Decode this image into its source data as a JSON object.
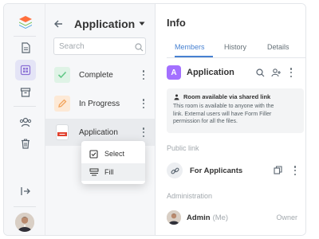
{
  "rail": {
    "logo_icon": "layers-logo-icon",
    "items": [
      "document-icon",
      "form-template-icon",
      "archive-icon",
      "users-icon",
      "trash-icon",
      "logout-icon"
    ],
    "active_item": "form-template-icon"
  },
  "files_panel": {
    "title": "Application",
    "search_placeholder": "Search",
    "items": [
      {
        "name": "Complete",
        "icon": "check-folder-icon",
        "color": "#61c786"
      },
      {
        "name": "In Progress",
        "icon": "pencil-folder-icon",
        "color": "#f2a45c"
      },
      {
        "name": "Application",
        "icon": "pdf-file-icon",
        "color": "#e0412e"
      }
    ],
    "context_menu": [
      {
        "label": "Select",
        "icon": "checkbox-icon"
      },
      {
        "label": "Fill",
        "icon": "form-fill-icon"
      }
    ]
  },
  "info_panel": {
    "title": "Info",
    "tabs": [
      "Members",
      "History",
      "Details"
    ],
    "active_tab": "Members",
    "room": {
      "badge": "A",
      "name": "Application",
      "badge_color": "#a370ff"
    },
    "notice": {
      "title": "Room available via shared link",
      "text_lines": [
        "This room is available to anyone with the",
        "link. External users will have Form Filler",
        "permission for all the files."
      ]
    },
    "public_link_label": "Public link",
    "public_link_name": "For Applicants",
    "administration_label": "Administration",
    "admin": {
      "name": "Admin",
      "me": "(Me)",
      "role": "Owner"
    }
  },
  "colors": {
    "accent": "#4781d1",
    "room_badge": "#a370ff",
    "pdf_red": "#e0412e"
  }
}
